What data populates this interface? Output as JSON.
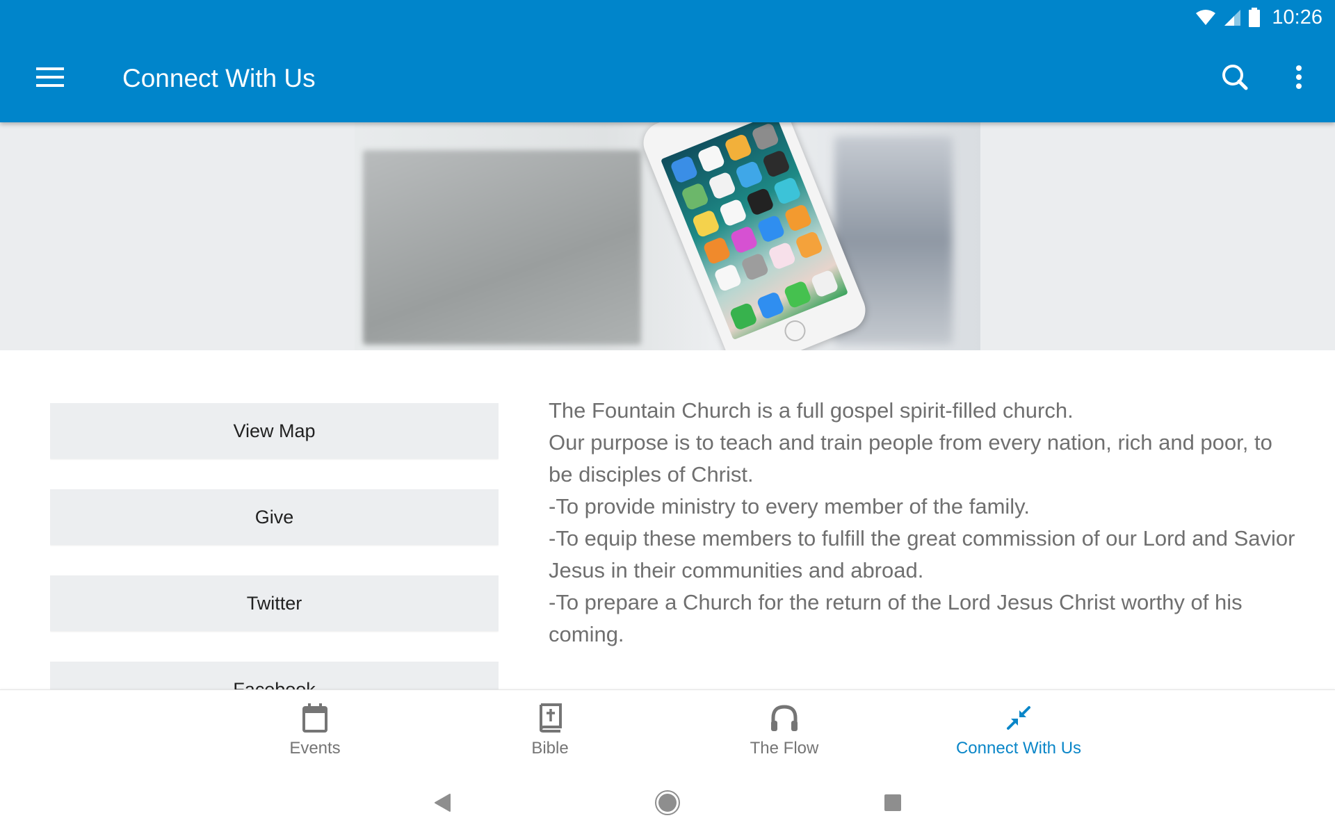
{
  "status_bar": {
    "time": "10:26",
    "icons": [
      "wifi-icon",
      "cellular-signal-icon",
      "battery-icon"
    ]
  },
  "app_bar": {
    "title": "Connect With Us",
    "menu_icon": "hamburger-menu-icon",
    "actions": [
      "search-icon",
      "more-vert-icon"
    ]
  },
  "hero": {
    "description": "Hand holding a smartphone showing home screen apps"
  },
  "actions": {
    "buttons": [
      {
        "label": "View Map"
      },
      {
        "label": "Give"
      },
      {
        "label": "Twitter"
      },
      {
        "label": "Facebook"
      }
    ]
  },
  "about": {
    "paragraphs": [
      "The Fountain Church is a full gospel spirit-filled church.",
      "Our purpose is to teach and train people from every nation, rich and poor, to be disciples of Christ.",
      "-To provide ministry to every member of the family.",
      "-To equip these members to fulfill the great commission of our Lord and Savior Jesus in their communities and abroad.",
      "-To prepare a Church for the return of the Lord Jesus Christ worthy of his coming."
    ]
  },
  "bottom_nav": {
    "items": [
      {
        "label": "Events",
        "icon": "calendar-icon",
        "active": false
      },
      {
        "label": "Bible",
        "icon": "bible-icon",
        "active": false
      },
      {
        "label": "The Flow",
        "icon": "headphones-icon",
        "active": false
      },
      {
        "label": "Connect With Us",
        "icon": "connect-arrows-icon",
        "active": true
      }
    ]
  },
  "system_nav": {
    "buttons": [
      "back-icon",
      "home-icon",
      "recents-icon"
    ]
  },
  "colors": {
    "primary": "#0085cb",
    "active_nav": "#0a86c8",
    "button_bg": "#eceef0",
    "body_text": "#6f6f6f",
    "inactive_nav": "#757575"
  }
}
